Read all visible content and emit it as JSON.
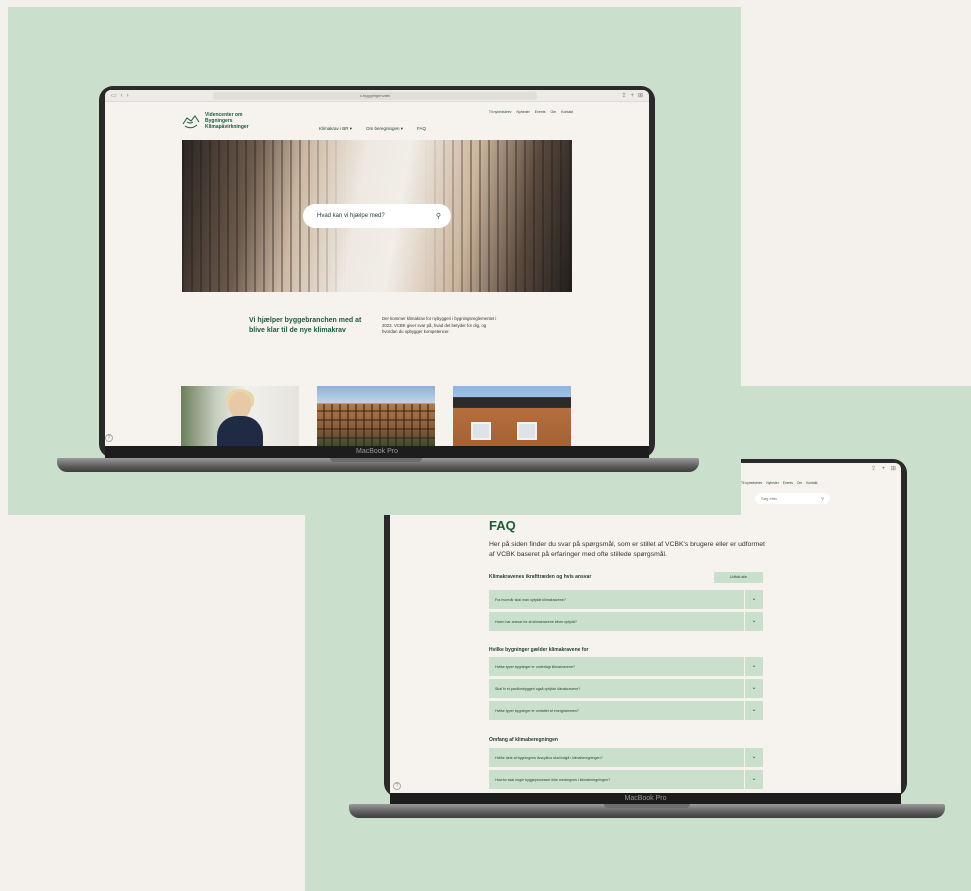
{
  "colors": {
    "bg": "#f4f1ec",
    "panel": "#cbe0cc",
    "brand": "#1f5a3a"
  },
  "laptop_label": "MacBook Pro",
  "site": {
    "url": "c.byggetigenvæk",
    "logo_lines": [
      "Videncenter om",
      "Bygningers",
      "Klimapåvirkninger"
    ],
    "top_links": [
      "Til nyhedsbrev",
      "Nyheder",
      "Events",
      "Om",
      "Kontakt"
    ],
    "menu": [
      "Klimakrav i BR ▾",
      "Om beregningen ▾",
      "FAQ"
    ],
    "hero_search_placeholder": "Hvad kan vi hjælpe med?",
    "intro_heading": "Vi hjælper byggebranchen med at blive klar til de nye klimakrav",
    "intro_text": "Der kommer klimakrav for nybyggeri i bygningsreglementet i 2023. VCBK giver svar på, hvad det betyder for dig, og hvordan du opbygger kompetencer."
  },
  "faq": {
    "search_placeholder": "Søg efter",
    "title": "FAQ",
    "intro": "Her på siden finder du svar på spørgsmål, som er stillet af VCBK's brugere eller er udformet af VCBK baseret på erfaringer med ofte stillede spørgsmål.",
    "show_all": "Udfold alle",
    "sections": [
      {
        "heading": "Klimakravenes ikrafttræden og hvis ansvar",
        "questions": [
          "Fra hvornår skal man opfylde klimakravene?",
          "Hvem har ansvar for at klimakravene bliver opfyldt?"
        ]
      },
      {
        "heading": "Hvilke bygninger gælder klimakravene for",
        "questions": [
          "Hvilke typer bygninger er underlagt klimakravene?",
          "Skal fx et pavillonbyggeri også opfylde klimakravene?",
          "Hvilke typer bygninger er omfattet af energirammen?"
        ]
      },
      {
        "heading": "Omfang af klimaberegningen",
        "questions": [
          "Hvilke dele af bygningens livscyklus skal indgå i klimaberegningen?",
          "Hvorfor skal nogle byggeprocesser ikke medregnes i klimaberegningen?"
        ]
      }
    ]
  }
}
